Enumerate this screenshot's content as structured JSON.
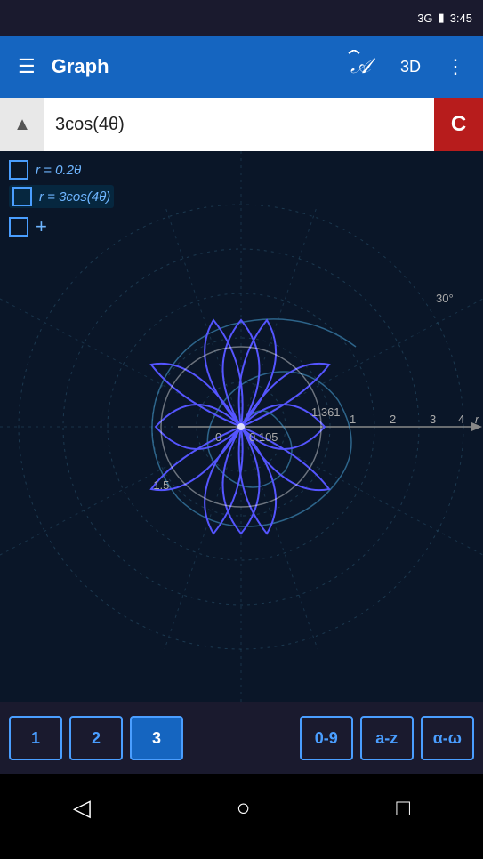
{
  "statusBar": {
    "signal": "3G",
    "time": "3:45",
    "batteryIcon": "🔋"
  },
  "navBar": {
    "menuIcon": "☰",
    "title": "Graph",
    "graphIcon": "𝒜",
    "btn3D": "3D",
    "moreIcon": "⋮"
  },
  "inputBar": {
    "collapseIcon": "▲",
    "value": "3cos(4θ)",
    "clearLabel": "C"
  },
  "equations": [
    {
      "id": "eq1",
      "text": "r = 0.2θ"
    },
    {
      "id": "eq2",
      "text": "r = 3cos(4θ)"
    }
  ],
  "graphLabels": {
    "angle30": "30°",
    "label0": "0",
    "label105": "0.105",
    "label1361": "1.361",
    "labelNeg15": "-1.5",
    "label1": "1",
    "label2": "2",
    "label3": "3",
    "label4": "4",
    "labelR": "r"
  },
  "bottomBar": {
    "btn1": "1",
    "btn2": "2",
    "btn3": "3",
    "btn09": "0-9",
    "btnAZ": "a-z",
    "btnAW": "α-ω"
  },
  "androidNav": {
    "backIcon": "◁",
    "homeIcon": "○",
    "recentIcon": "□"
  }
}
